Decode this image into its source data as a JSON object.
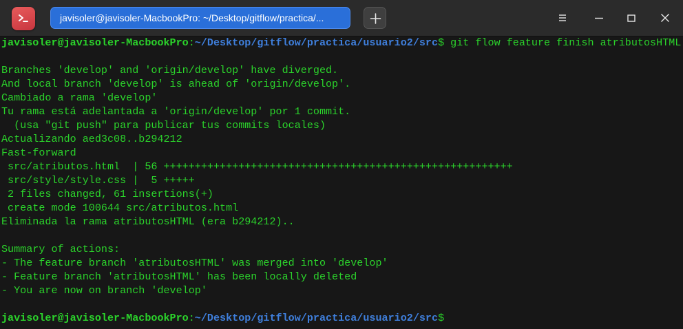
{
  "window": {
    "tab_title": "javisoler@javisoler-MacbookPro: ~/Desktop/gitflow/practica/...",
    "app_icon": "terminal-icon",
    "new_tab_icon": "plus-icon",
    "controls": [
      "menu-icon",
      "minimize-icon",
      "maximize-icon",
      "close-icon"
    ]
  },
  "prompt": {
    "user_host": "javisoler@javisoler-MacbookPro",
    "sep": ":",
    "path": "~/Desktop/gitflow/practica/usuario2/src",
    "symbol": "$",
    "command": " git flow feature finish atributosHTML"
  },
  "output": [
    "",
    "Branches 'develop' and 'origin/develop' have diverged.",
    "And local branch 'develop' is ahead of 'origin/develop'.",
    "Cambiado a rama 'develop'",
    "Tu rama está adelantada a 'origin/develop' por 1 commit.",
    "  (usa \"git push\" para publicar tus commits locales)",
    "Actualizando aed3c08..b294212",
    "Fast-forward",
    " src/atributos.html  | 56 ++++++++++++++++++++++++++++++++++++++++++++++++++++++++",
    " src/style/style.css |  5 +++++",
    " 2 files changed, 61 insertions(+)",
    " create mode 100644 src/atributos.html",
    "Eliminada la rama atributosHTML (era b294212)..",
    "",
    "Summary of actions:",
    "- The feature branch 'atributosHTML' was merged into 'develop'",
    "- Feature branch 'atributosHTML' has been locally deleted",
    "- You are now on branch 'develop'",
    ""
  ],
  "prompt2": {
    "user_host": "javisoler@javisoler-MacbookPro",
    "sep": ":",
    "path": "~/Desktop/gitflow/practica/usuario2/src",
    "symbol": "$"
  },
  "colors": {
    "text_green": "#2bd32b",
    "path_blue": "#3f7fdc",
    "tab_blue": "#2a6fd9",
    "background": "#171717"
  }
}
